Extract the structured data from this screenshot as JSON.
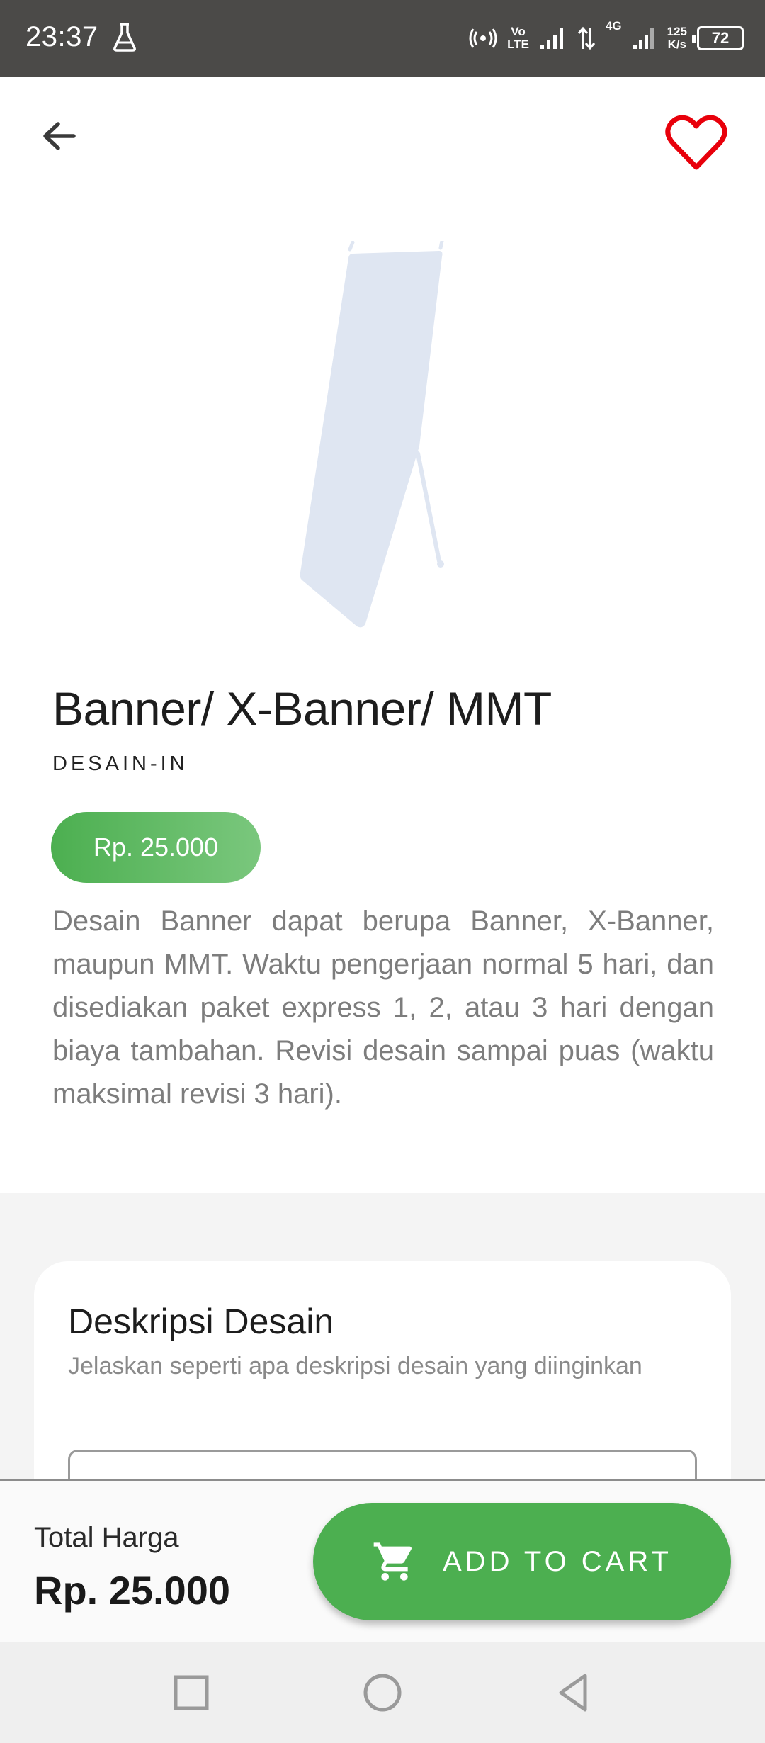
{
  "status_bar": {
    "time": "23:37",
    "volte_top": "Vo",
    "volte_bottom": "LTE",
    "network": "4G",
    "speed_value": "125",
    "speed_unit": "K/s",
    "battery": "72"
  },
  "product": {
    "title": "Banner/ X-Banner/ MMT",
    "category": "DESAIN-IN",
    "price": "Rp. 25.000",
    "description": "Desain Banner dapat berupa Banner, X-Banner, maupun MMT. Waktu pengerjaan normal 5 hari, dan disediakan paket express 1, 2, atau 3 hari dengan biaya tambahan. Revisi desain sampai puas (waktu maksimal revisi 3 hari).",
    "image_icon": "x-banner-stand-image"
  },
  "form": {
    "title": "Deskripsi Desain",
    "subtitle": "Jelaskan seperti apa deskripsi desain yang diinginkan",
    "input_value": ""
  },
  "bottom": {
    "total_label": "Total Harga",
    "total_value": "Rp. 25.000",
    "cart_label": "ADD TO CART",
    "cart_icon": "cart-icon"
  },
  "colors": {
    "accent_green": "#4caf50",
    "favorite_red": "#e8000b",
    "status_bar": "#4b4a48",
    "image_tint": "#dfe6f2"
  }
}
